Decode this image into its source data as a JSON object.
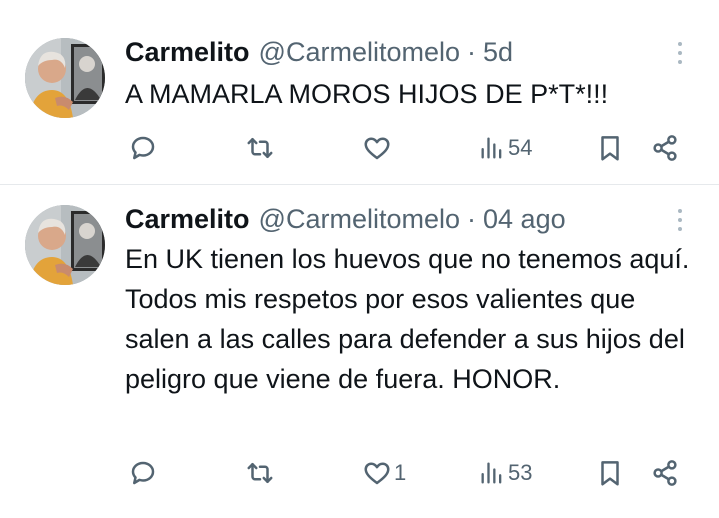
{
  "colors": {
    "text": "#0f1419",
    "secondary": "#536471",
    "divider": "#e6e9ec"
  },
  "tweets": [
    {
      "author": {
        "name": "Carmelito",
        "handle": "@Carmelitomelo"
      },
      "time": "5d",
      "separator": "·",
      "text": "A MAMARLA MOROS HIJOS DE P*T*!!!",
      "stats": {
        "replies": "",
        "retweets": "",
        "likes": "",
        "views": "54"
      },
      "icons": [
        "reply-icon",
        "retweet-icon",
        "like-icon",
        "views-icon",
        "bookmark-icon",
        "share-icon",
        "more-icon"
      ]
    },
    {
      "author": {
        "name": "Carmelito",
        "handle": "@Carmelitomelo"
      },
      "time": "04 ago",
      "separator": "·",
      "text": "En UK tienen los huevos que no tenemos aquí. Todos mis respetos por esos valientes que salen a las calles para defender a sus hijos del peligro que viene de fuera. HONOR.",
      "stats": {
        "replies": "",
        "retweets": "",
        "likes": "1",
        "views": "53"
      },
      "icons": [
        "reply-icon",
        "retweet-icon",
        "like-icon",
        "views-icon",
        "bookmark-icon",
        "share-icon",
        "more-icon"
      ]
    }
  ]
}
